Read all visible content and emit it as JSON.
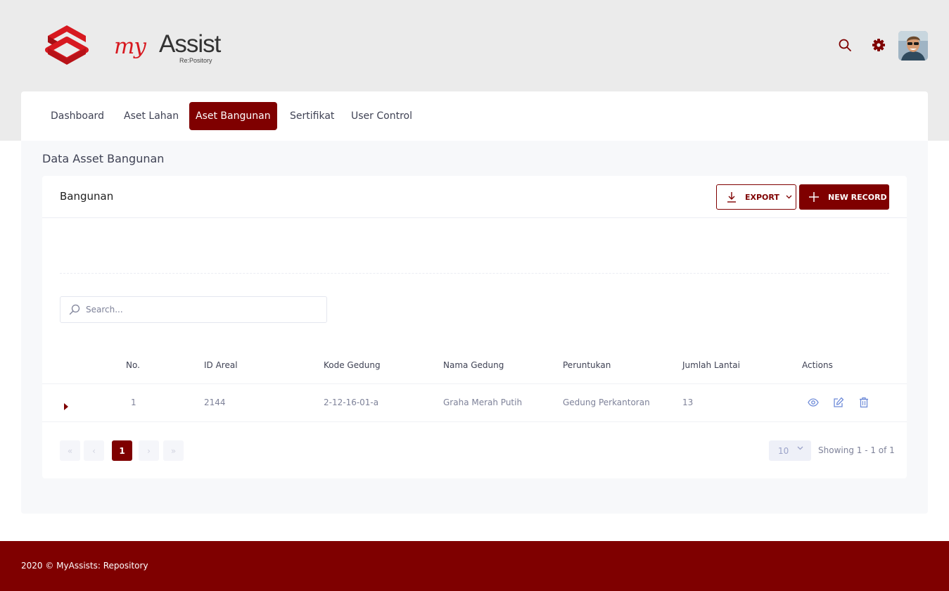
{
  "brand": {
    "logo_icon": "myassist-logo-icon",
    "name_my": "my",
    "name_assist": "Assist",
    "subtitle": "Re:Pository"
  },
  "header": {
    "icons": [
      "search-icon",
      "gear-icon"
    ],
    "avatar": "user-avatar"
  },
  "nav": {
    "items": [
      {
        "label": "Dashboard",
        "active": false
      },
      {
        "label": "Aset Lahan",
        "active": false
      },
      {
        "label": "Aset Bangunan",
        "active": true
      },
      {
        "label": "Sertifikat",
        "active": false
      },
      {
        "label": "User Control",
        "active": false
      }
    ]
  },
  "page": {
    "title": "Data Asset Bangunan"
  },
  "card": {
    "title": "Bangunan",
    "export_label": "EXPORT",
    "new_record_label": "NEW RECORD"
  },
  "search": {
    "placeholder": "Search...",
    "value": ""
  },
  "table": {
    "columns": [
      "No.",
      "ID Areal",
      "Kode Gedung",
      "Nama Gedung",
      "Peruntukan",
      "Jumlah Lantai",
      "Actions"
    ],
    "rows": [
      {
        "no": "1",
        "id_areal": "2144",
        "kode_gedung": "2-12-16-01-a",
        "nama_gedung": "Graha Merah Putih",
        "peruntukan": "Gedung Perkantoran",
        "jumlah_lantai": "13",
        "actions": [
          "view-icon",
          "edit-icon",
          "delete-icon"
        ]
      }
    ]
  },
  "pagination": {
    "first": "«",
    "prev": "‹",
    "current_page": "1",
    "next": "›",
    "last": "»",
    "per_page": "10",
    "showing": "Showing 1 - 1 of 1"
  },
  "footer": {
    "text": "2020 © MyAssists: Repository"
  },
  "colors": {
    "brand_primary": "#7f0000",
    "logo_red": "#d71920",
    "header_bg": "#ebebeb",
    "content_bg": "#f7f8fa",
    "action_icon": "#6e8bd8"
  }
}
